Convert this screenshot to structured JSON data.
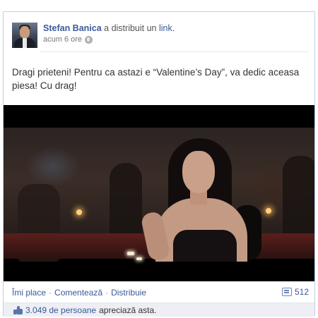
{
  "post": {
    "author": "Stefan Banica",
    "verb": "a distribuit un",
    "link_word": "link.",
    "time": "acum 6 ore",
    "message": "Dragi prieteni! Pentru ca astazi e “Valentine’s Day”, va dedic aceasa piesa! Cu drag!"
  },
  "actions": {
    "like": "Îmi place",
    "comment": "Comentează",
    "share": "Distribuie",
    "separator": "·",
    "comments_count": "512"
  },
  "likes": {
    "count": "3.049 de persoane",
    "text": "apreciază asta."
  },
  "colors": {
    "link_blue": "#3b5998",
    "likes_bar": "#edeff4"
  }
}
